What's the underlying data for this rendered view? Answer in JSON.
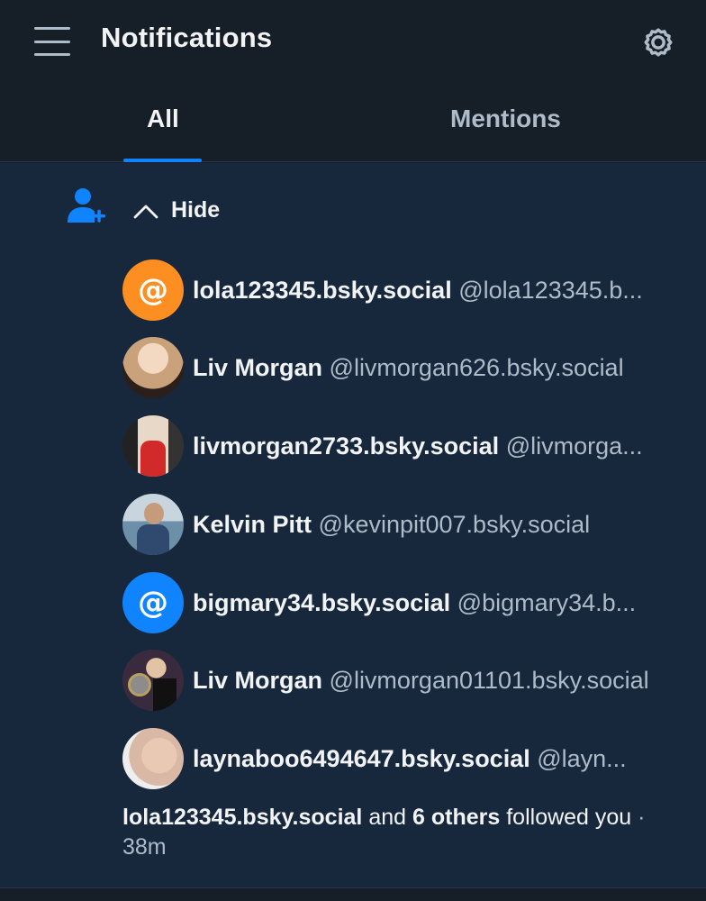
{
  "header": {
    "title": "Notifications",
    "menu_icon": "hamburger-menu-icon",
    "settings_icon": "gear-icon"
  },
  "tabs": [
    {
      "label": "All",
      "active": true
    },
    {
      "label": "Mentions",
      "active": false
    }
  ],
  "notification": {
    "type_icon": "person-plus-icon",
    "hide_label": "Hide",
    "users": [
      {
        "name": "lola123345.bsky.social",
        "handle": "@lola123345.b...",
        "avatar": "at-default",
        "avatar_color": "#fd8e21"
      },
      {
        "name": "Liv Morgan",
        "handle": "@livmorgan626.bsky.social",
        "avatar": "photo",
        "avatar_color": "#c9a17a"
      },
      {
        "name": "livmorgan2733.bsky.social",
        "handle": "@livmorga...",
        "avatar": "photo",
        "avatar_color": "#8a4a3a"
      },
      {
        "name": "Kelvin Pitt",
        "handle": "@kevinpit007.bsky.social",
        "avatar": "photo",
        "avatar_color": "#6e8fa8"
      },
      {
        "name": "bigmary34.bsky.social",
        "handle": "@bigmary34.b...",
        "avatar": "at-default",
        "avatar_color": "#1083fe"
      },
      {
        "name": "Liv Morgan",
        "handle": "@livmorgan01101.bsky.social",
        "avatar": "photo",
        "avatar_color": "#3a2a3e"
      },
      {
        "name": "laynaboo6494647.bsky.social",
        "handle": "@layn...",
        "avatar": "photo",
        "avatar_color": "#d9b8a6"
      }
    ],
    "summary": {
      "first": "lola123345.bsky.social",
      "and": "and",
      "others": "6 others",
      "action": "followed you",
      "sep": "·",
      "time": "38m"
    }
  },
  "colors": {
    "accent": "#1083fe",
    "background": "#161e27",
    "feed_background": "#17283d",
    "muted_text": "#aebbc9"
  }
}
